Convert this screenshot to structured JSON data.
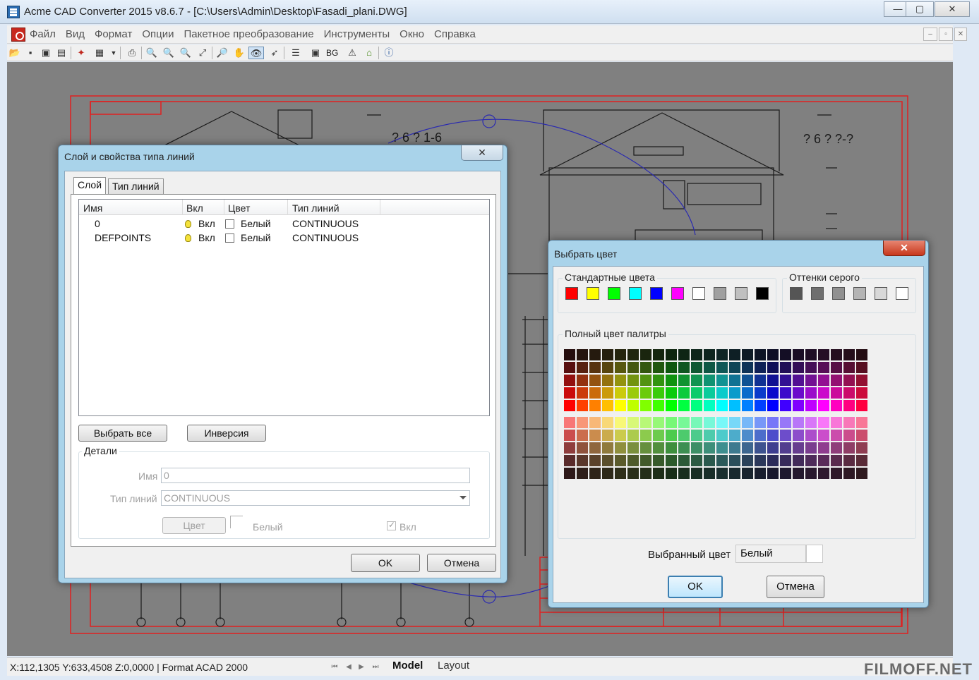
{
  "window": {
    "title": "Acme CAD Converter 2015 v8.6.7 - [C:\\Users\\Admin\\Desktop\\Fasadi_plani.DWG]",
    "minimize_label": "—",
    "maximize_label": "▢",
    "close_label": "✕"
  },
  "menu": {
    "items": [
      "Файл",
      "Вид",
      "Формат",
      "Опции",
      "Пакетное преобразование",
      "Инструменты",
      "Окно",
      "Справка"
    ],
    "mdi": [
      "–",
      "▫",
      "✕"
    ]
  },
  "toolbar": {
    "icons": [
      "open-icon",
      "save-icon",
      "save-all-icon",
      "export-icon",
      "pdf-icon",
      "batch-icon",
      "print-icon",
      "zoom-out-icon",
      "zoom-in-icon",
      "zoom-window-icon",
      "zoom-realtime-icon",
      "zoom-extents-icon",
      "pan-icon",
      "eye-icon",
      "pointer-icon",
      "layers-icon",
      "background-icon",
      "bg-text",
      "warning-icon",
      "home-icon",
      "info-icon"
    ],
    "bg_label": "BG"
  },
  "drawing": {
    "texts": [
      "? 6 ? 1-6",
      "? 6 ? ?-?"
    ]
  },
  "status": {
    "coords": "X:112,1305 Y:633,4508 Z:0,0000 | Format ACAD 2000",
    "tabs": [
      "Model",
      "Layout"
    ]
  },
  "watermark": "FILMOFF.NET",
  "layer_dialog": {
    "title": "Слой и свойства типа линий",
    "close_label": "✕",
    "tabs": [
      "Слой",
      "Тип линий"
    ],
    "columns": [
      "Имя",
      "Вкл",
      "Цвет",
      "Тип линий"
    ],
    "rows": [
      {
        "name": "0",
        "on": "Вкл",
        "color": "Белый",
        "linetype": "CONTINUOUS"
      },
      {
        "name": "DEFPOINTS",
        "on": "Вкл",
        "color": "Белый",
        "linetype": "CONTINUOUS"
      }
    ],
    "select_all_label": "Выбрать все",
    "invert_label": "Инверсия",
    "details": {
      "group_label": "Детали",
      "name_label": "Имя",
      "name_value": "0",
      "linetype_label": "Тип линий",
      "linetype_value": "CONTINUOUS",
      "color_button": "Цвет",
      "color_value": "Белый",
      "on_label": "Вкл",
      "on_checked": true
    },
    "ok_label": "OK",
    "cancel_label": "Отмена"
  },
  "color_dialog": {
    "title": "Выбрать цвет",
    "close_label": "✕",
    "standard_label": "Стандартные цвета",
    "standard_colors": [
      "#ff0000",
      "#ffff00",
      "#00ff00",
      "#00ffff",
      "#0000ff",
      "#ff00ff",
      "#ffffff",
      "#a0a0a0",
      "#c0c0c0",
      "#000000"
    ],
    "gray_label": "Оттенки серого",
    "gray_colors": [
      "#555555",
      "#6f6f6f",
      "#909090",
      "#b4b4b4",
      "#d8d8d8",
      "#ffffff"
    ],
    "palette_label": "Полный цвет палитры",
    "selected_label": "Выбранный цвет",
    "selected_value": "Белый",
    "selected_color": "#ffffff",
    "ok_label": "OK",
    "cancel_label": "Отмена"
  }
}
